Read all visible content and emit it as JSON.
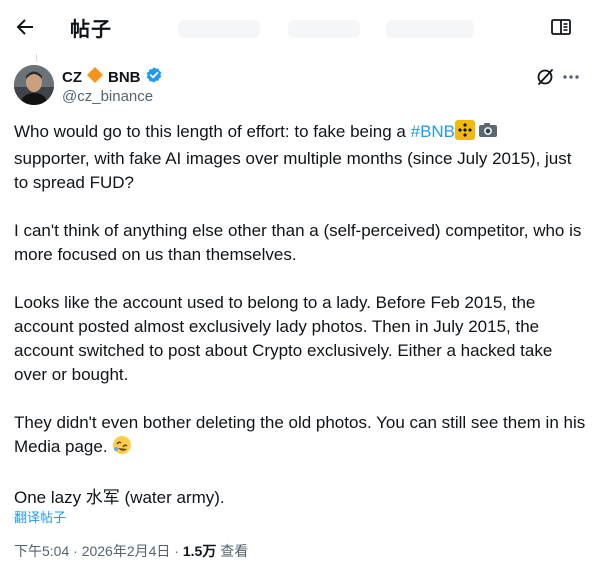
{
  "header": {
    "title": "帖子"
  },
  "author": {
    "display_name": "CZ",
    "suffix": "BNB",
    "handle": "@cz_binance"
  },
  "tweet": {
    "p1a": "Who would go to this length of effort: to fake being a ",
    "hashtag": "#BNB",
    "p1b": "supporter, with fake AI images over multiple months (since July 2015), just to spread FUD?",
    "p2": "I can't think of anything else other than a (self-perceived) competitor, who is more focused on us than themselves.",
    "p3": "Looks like the account used to belong to a lady. Before Feb 2015, the account posted almost exclusively lady photos. Then in July 2015, the account switched to post about Crypto exclusively. Either a hacked take over or bought.",
    "p4": "They didn't even bother deleting the old photos. You can still see them in his Media page.",
    "p5": "One lazy 水军 (water army)."
  },
  "translate_label": "翻译帖子",
  "meta": {
    "time": "下午5:04",
    "sep": " · ",
    "date": "2026年2月4日",
    "views": "1.5万",
    "views_label": "查看"
  },
  "colors": {
    "link": "#1d9bf0",
    "bnb": "#f0b90b",
    "verified": "#1d9bf0",
    "diamond": "#f7931a"
  },
  "icons": [
    "back-arrow-icon",
    "reader-mode-icon",
    "diamond-icon",
    "verified-badge-icon",
    "grok-icon",
    "more-icon",
    "bnb-logo-icon",
    "camera-emoji",
    "rofl-emoji"
  ]
}
